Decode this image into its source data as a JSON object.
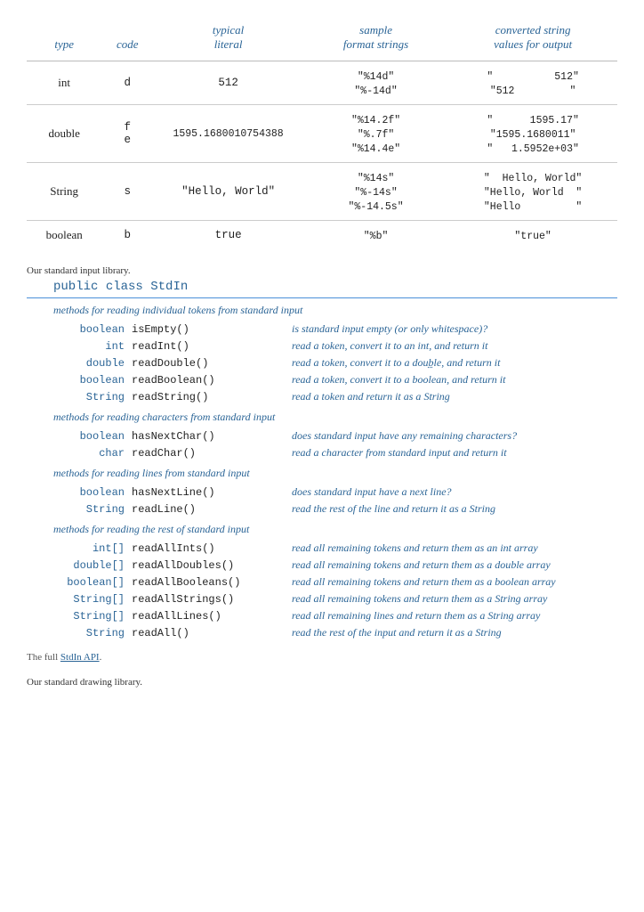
{
  "table": {
    "headers": [
      "type",
      "code",
      "typical\nliteral",
      "sample\nformat strings",
      "converted string\nvalues for output"
    ],
    "rows": [
      {
        "type": "int",
        "code": "d",
        "literal": "512",
        "samples": [
          "\"%14d\"",
          "\"%-14d\""
        ],
        "converted": [
          "\"          512\"",
          "\"512          \""
        ]
      },
      {
        "type": "double",
        "code_lines": [
          "f",
          "e"
        ],
        "literal": "1595.1680010754388",
        "samples": [
          "\"%14.2f\"",
          "\"%.7f\"",
          "\"%14.4e\""
        ],
        "converted": [
          "\"      1595.17\"",
          "\"1595.1680011\"",
          "\"   1.5952e+03\""
        ]
      },
      {
        "type": "String",
        "code": "s",
        "literal": "\"Hello, World\"",
        "samples": [
          "\"%14s\"",
          "\"%-14s\"",
          "\"%-14.5s\""
        ],
        "converted": [
          "\"  Hello, World\"",
          "\"Hello, World  \"",
          "\"Hello         \""
        ]
      },
      {
        "type": "boolean",
        "code": "b",
        "literal": "true",
        "samples": [
          "\"%b\""
        ],
        "converted": [
          "\"true\""
        ]
      }
    ]
  },
  "api": {
    "intro": "Our standard input library.",
    "class_declaration": "public class StdIn",
    "groups": [
      {
        "label": "methods for reading individual tokens from standard input",
        "methods": [
          {
            "return_type": "boolean",
            "name": "isEmpty()",
            "desc": "is standard input empty (or only whitespace)?"
          },
          {
            "return_type": "int",
            "name": "readInt()",
            "desc": "read a token, convert it to an int, and return it"
          },
          {
            "return_type": "double",
            "name": "readDouble()",
            "desc": "read a token, convert it to a double, and return it"
          },
          {
            "return_type": "boolean",
            "name": "readBoolean()",
            "desc": "read a token, convert it to a boolean, and return it"
          },
          {
            "return_type": "String",
            "name": "readString()",
            "desc": "read a token and return it as a String"
          }
        ]
      },
      {
        "label": "methods for reading characters from standard input",
        "methods": [
          {
            "return_type": "boolean",
            "name": "hasNextChar()",
            "desc": "does standard input have any remaining characters?"
          },
          {
            "return_type": "char",
            "name": "readChar()",
            "desc": "read a character from standard input and return it"
          }
        ]
      },
      {
        "label": "methods for reading lines from standard input",
        "methods": [
          {
            "return_type": "boolean",
            "name": "hasNextLine()",
            "desc": "does standard input have a next line?"
          },
          {
            "return_type": "String",
            "name": "readLine()",
            "desc": "read the rest of the line and return it as a String"
          }
        ]
      },
      {
        "label": "methods for reading the rest of standard input",
        "methods": [
          {
            "return_type": "int[]",
            "name": "readAllInts()",
            "desc": "read all remaining tokens and return them as an int array"
          },
          {
            "return_type": "double[]",
            "name": "readAllDoubles()",
            "desc": "read all remaining tokens and return them as a double array"
          },
          {
            "return_type": "boolean[]",
            "name": "readAllBooleans()",
            "desc": "read all remaining tokens and return them as a boolean array"
          },
          {
            "return_type": "String[]",
            "name": "readAllStrings()",
            "desc": "read all remaining tokens and return them as a String array"
          },
          {
            "return_type": "String[]",
            "name": "readAllLines()",
            "desc": "read all remaining lines and return them as a String array"
          },
          {
            "return_type": "String",
            "name": "readAll()",
            "desc": "read the rest of the input and return it as a String"
          }
        ]
      }
    ],
    "full_link_text": "The full StdIn API.",
    "full_link_label": "StdIn API"
  },
  "drawing": {
    "intro": "Our standard drawing library."
  }
}
